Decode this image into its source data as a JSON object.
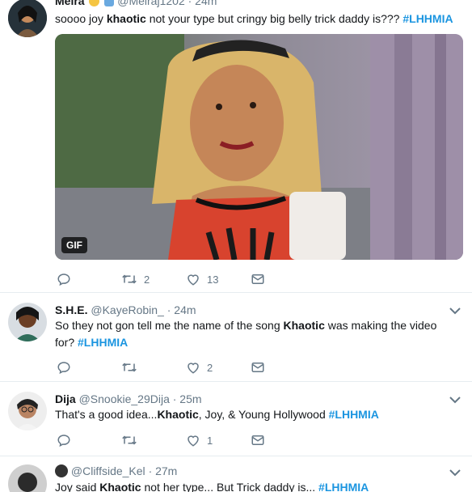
{
  "tweets": [
    {
      "name": "Meira",
      "handle": "@Meiraj1202",
      "time": "· 24m",
      "parts": [
        {
          "t": "soooo joy ",
          "k": "plain"
        },
        {
          "t": "khaotic",
          "k": "bold"
        },
        {
          "t": " not your type but cringy big belly trick daddy is??? ",
          "k": "plain"
        },
        {
          "t": "#LHHMIA",
          "k": "tag"
        }
      ],
      "media_badge": "GIF",
      "actions": {
        "reply": "",
        "retweet": "2",
        "like": "13"
      }
    },
    {
      "name": "S.H.E.",
      "handle": "@KayeRobin_",
      "time": "· 24m",
      "parts": [
        {
          "t": "So they not gon tell me the name of the song ",
          "k": "plain"
        },
        {
          "t": "Khaotic",
          "k": "bold"
        },
        {
          "t": " was making the video for? ",
          "k": "plain"
        },
        {
          "t": "#LHHMIA",
          "k": "tag"
        }
      ],
      "actions": {
        "reply": "",
        "retweet": "",
        "like": "2"
      }
    },
    {
      "name": "Dija",
      "handle": "@Snookie_29Dija",
      "time": "· 25m",
      "parts": [
        {
          "t": "That's a good idea...",
          "k": "plain"
        },
        {
          "t": "Khaotic",
          "k": "bold"
        },
        {
          "t": ", Joy, & Young Hollywood ",
          "k": "plain"
        },
        {
          "t": "#LHHMIA",
          "k": "tag"
        }
      ],
      "actions": {
        "reply": "",
        "retweet": "",
        "like": "1"
      }
    },
    {
      "name": "",
      "handle": "@Cliffside_Kel",
      "time": "· 27m",
      "parts": [
        {
          "t": "Joy said ",
          "k": "plain"
        },
        {
          "t": "Khaotic",
          "k": "bold"
        },
        {
          "t": " not her type... But Trick daddy is... ",
          "k": "plain"
        },
        {
          "t": "#LHHMIA",
          "k": "tag"
        }
      ],
      "actions": {
        "reply": "",
        "retweet": "",
        "like": ""
      }
    }
  ],
  "colors": {
    "accent": "#1b95e0",
    "muted": "#657786",
    "border": "#e6ecf0"
  },
  "icons": [
    "reply-icon",
    "retweet-icon",
    "like-icon",
    "direct-message-icon",
    "chevron-down-icon"
  ]
}
